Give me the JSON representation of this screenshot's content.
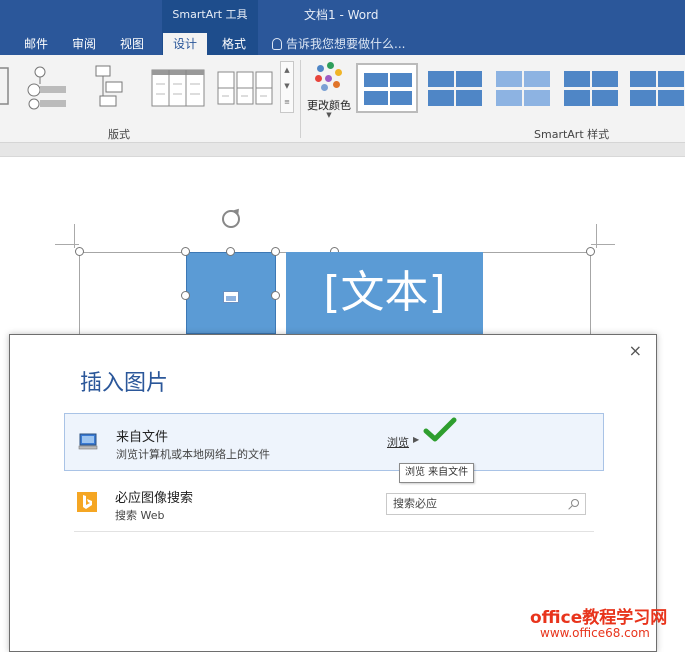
{
  "window": {
    "contextual_label": "SmartArt 工具",
    "doc_title": "文档1 - Word"
  },
  "tabs": [
    {
      "label": "邮件",
      "active": false
    },
    {
      "label": "审阅",
      "active": false
    },
    {
      "label": "视图",
      "active": false
    },
    {
      "label": "设计",
      "active": true
    },
    {
      "label": "格式",
      "active": false
    }
  ],
  "tell_me": "告诉我您想要做什么...",
  "ribbon": {
    "layouts_group_label": "版式",
    "change_colors_label": "更改颜色",
    "styles_group_label": "SmartArt 样式"
  },
  "smartart": {
    "text_placeholder": "[文本]"
  },
  "dialog": {
    "title": "插入图片",
    "close_glyph": "×",
    "from_file": {
      "title": "来自文件",
      "subtitle": "浏览计算机或本地网络上的文件",
      "browse_link": "浏览",
      "browse_arrow": "▶",
      "tooltip": "浏览 来自文件"
    },
    "bing": {
      "title": "必应图像搜索",
      "subtitle": "搜索 Web",
      "search_placeholder": "搜索必应"
    }
  },
  "watermark": {
    "line1": "office教程学习网",
    "line2": "www.office68.com"
  },
  "colors": {
    "ribbon_blue": "#2b579a",
    "shape_blue": "#5b9bd5",
    "check_green": "#2e9e2e",
    "watermark_red": "#e8341c"
  },
  "icons": [
    "lightbulb-icon",
    "rotate-handle-icon",
    "picture-icon",
    "computer-icon",
    "bing-icon",
    "search-icon",
    "checkmark-icon",
    "close-icon"
  ]
}
